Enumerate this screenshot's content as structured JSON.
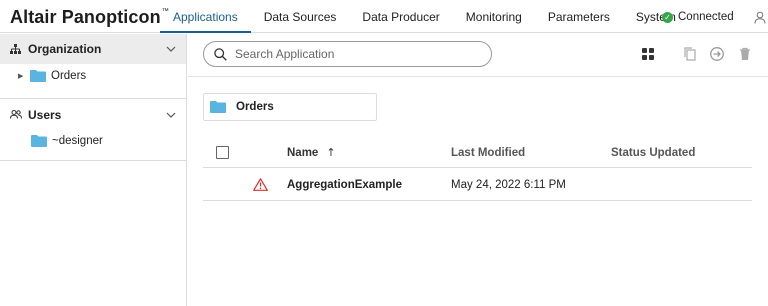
{
  "app": {
    "title": "Altair Panopticon",
    "trademark": "™"
  },
  "nav": {
    "tabs": [
      {
        "label": "Applications",
        "active": true
      },
      {
        "label": "Data Sources",
        "active": false
      },
      {
        "label": "Data Producer",
        "active": false
      },
      {
        "label": "Monitoring",
        "active": false
      },
      {
        "label": "Parameters",
        "active": false
      },
      {
        "label": "System",
        "active": false
      }
    ]
  },
  "connection": {
    "status": "Connected",
    "color": "#3aa54a"
  },
  "sidebar": {
    "organization": {
      "label": "Organization",
      "items": [
        {
          "label": "Orders"
        }
      ]
    },
    "users": {
      "label": "Users",
      "items": [
        {
          "label": "~designer"
        }
      ]
    }
  },
  "search": {
    "placeholder": "Search Application",
    "value": ""
  },
  "toolbar": {
    "icons": [
      "grid-view-icon",
      "copy-icon",
      "move-icon",
      "delete-icon"
    ]
  },
  "breadcrumb": {
    "folder": "Orders"
  },
  "table": {
    "columns": {
      "name": "Name",
      "last_modified": "Last Modified",
      "status_updated": "Status Updated"
    },
    "sort": {
      "column": "name",
      "direction": "ascending",
      "glyph": "↑"
    },
    "rows": [
      {
        "name": "AggregationExample",
        "last_modified": "May 24, 2022 6:11 PM",
        "status_updated": "",
        "status_icon": "warning-icon"
      }
    ]
  },
  "colors": {
    "accent": "#1a5f8f",
    "folder": "#5ab4e0",
    "warning": "#d9302c",
    "connected": "#3aa54a"
  }
}
